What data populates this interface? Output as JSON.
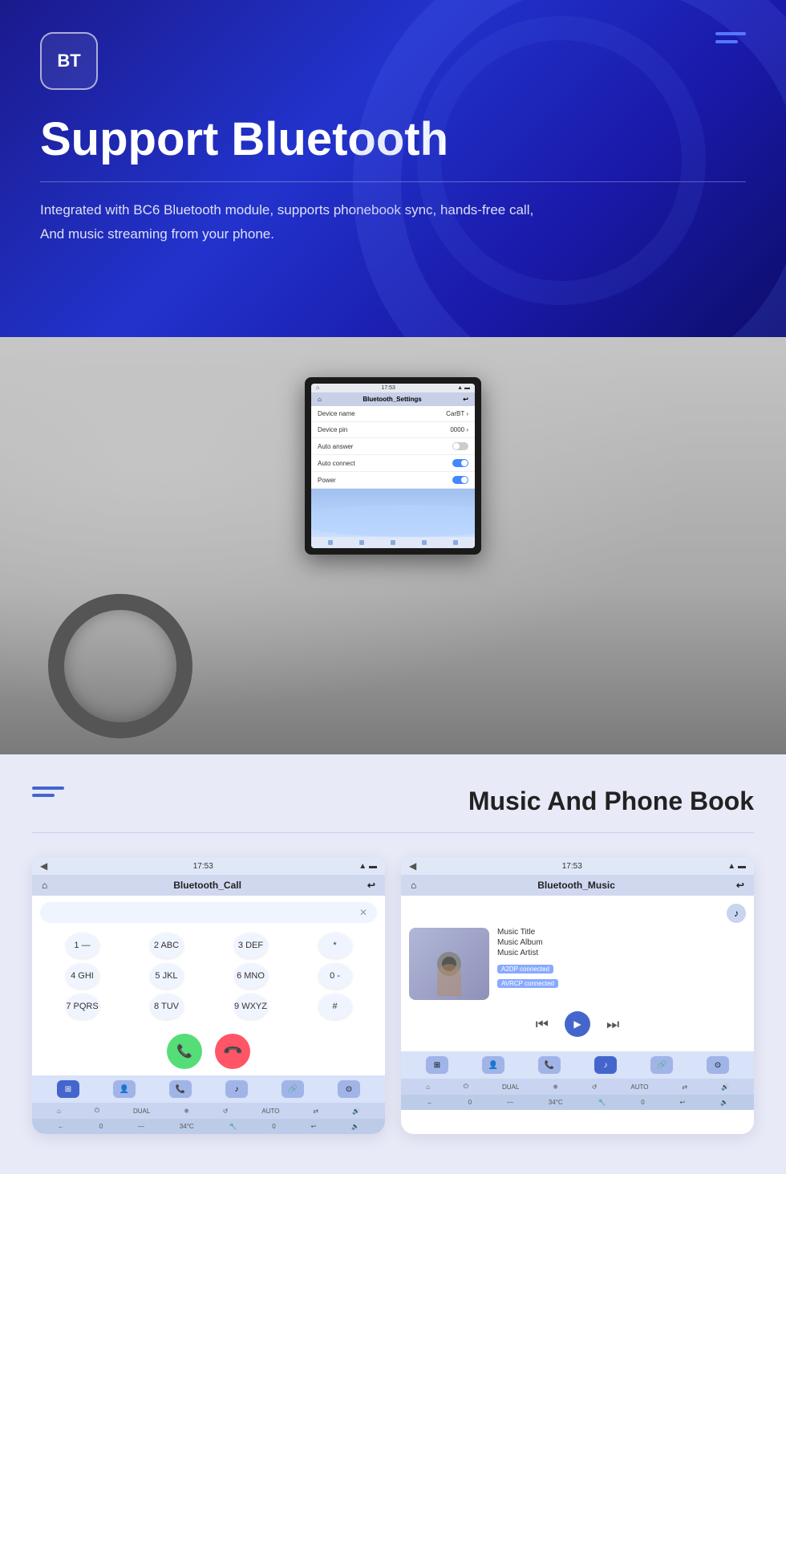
{
  "hero": {
    "bt_logo": "BT",
    "title": "Support Bluetooth",
    "description_line1": "Integrated with BC6 Bluetooth module, supports phonebook sync, hands-free call,",
    "description_line2": "And music streaming from your phone.",
    "divider": true
  },
  "car_screen": {
    "topbar_time": "17:53",
    "header_title": "Bluetooth_Settings",
    "rows": [
      {
        "label": "Device name",
        "value": "CarBT",
        "has_arrow": true
      },
      {
        "label": "Device pin",
        "value": "0000",
        "has_arrow": true
      },
      {
        "label": "Auto answer",
        "toggle": "off"
      },
      {
        "label": "Auto connect",
        "toggle": "on"
      },
      {
        "label": "Power",
        "toggle": "on"
      }
    ]
  },
  "music_section": {
    "title": "Music And Phone Book",
    "call_screen": {
      "topbar_time": "17:53",
      "header_title": "Bluetooth_Call",
      "input_placeholder": "",
      "dialpad": [
        [
          "1 —",
          "2 ABC",
          "3 DEF",
          "*"
        ],
        [
          "4 GHI",
          "5 JKL",
          "6 MNO",
          "0 -"
        ],
        [
          "7 PQRS",
          "8 TUV",
          "9 WXYZ",
          "#"
        ]
      ],
      "call_button": "📞",
      "end_button": "📞",
      "nav_items": [
        "⊞",
        "👤",
        "📞",
        "♪",
        "🔗",
        "⊙"
      ]
    },
    "music_screen": {
      "topbar_time": "17:53",
      "header_title": "Bluetooth_Music",
      "music_title": "Music Title",
      "music_album": "Music Album",
      "music_artist": "Music Artist",
      "badge1": "A2DP connected",
      "badge2": "AVRCP connected",
      "controls": [
        "⏮",
        "▶",
        "⏭"
      ],
      "nav_items": [
        "⊞",
        "👤",
        "📞",
        "♪",
        "🔗",
        "⊙"
      ]
    }
  }
}
